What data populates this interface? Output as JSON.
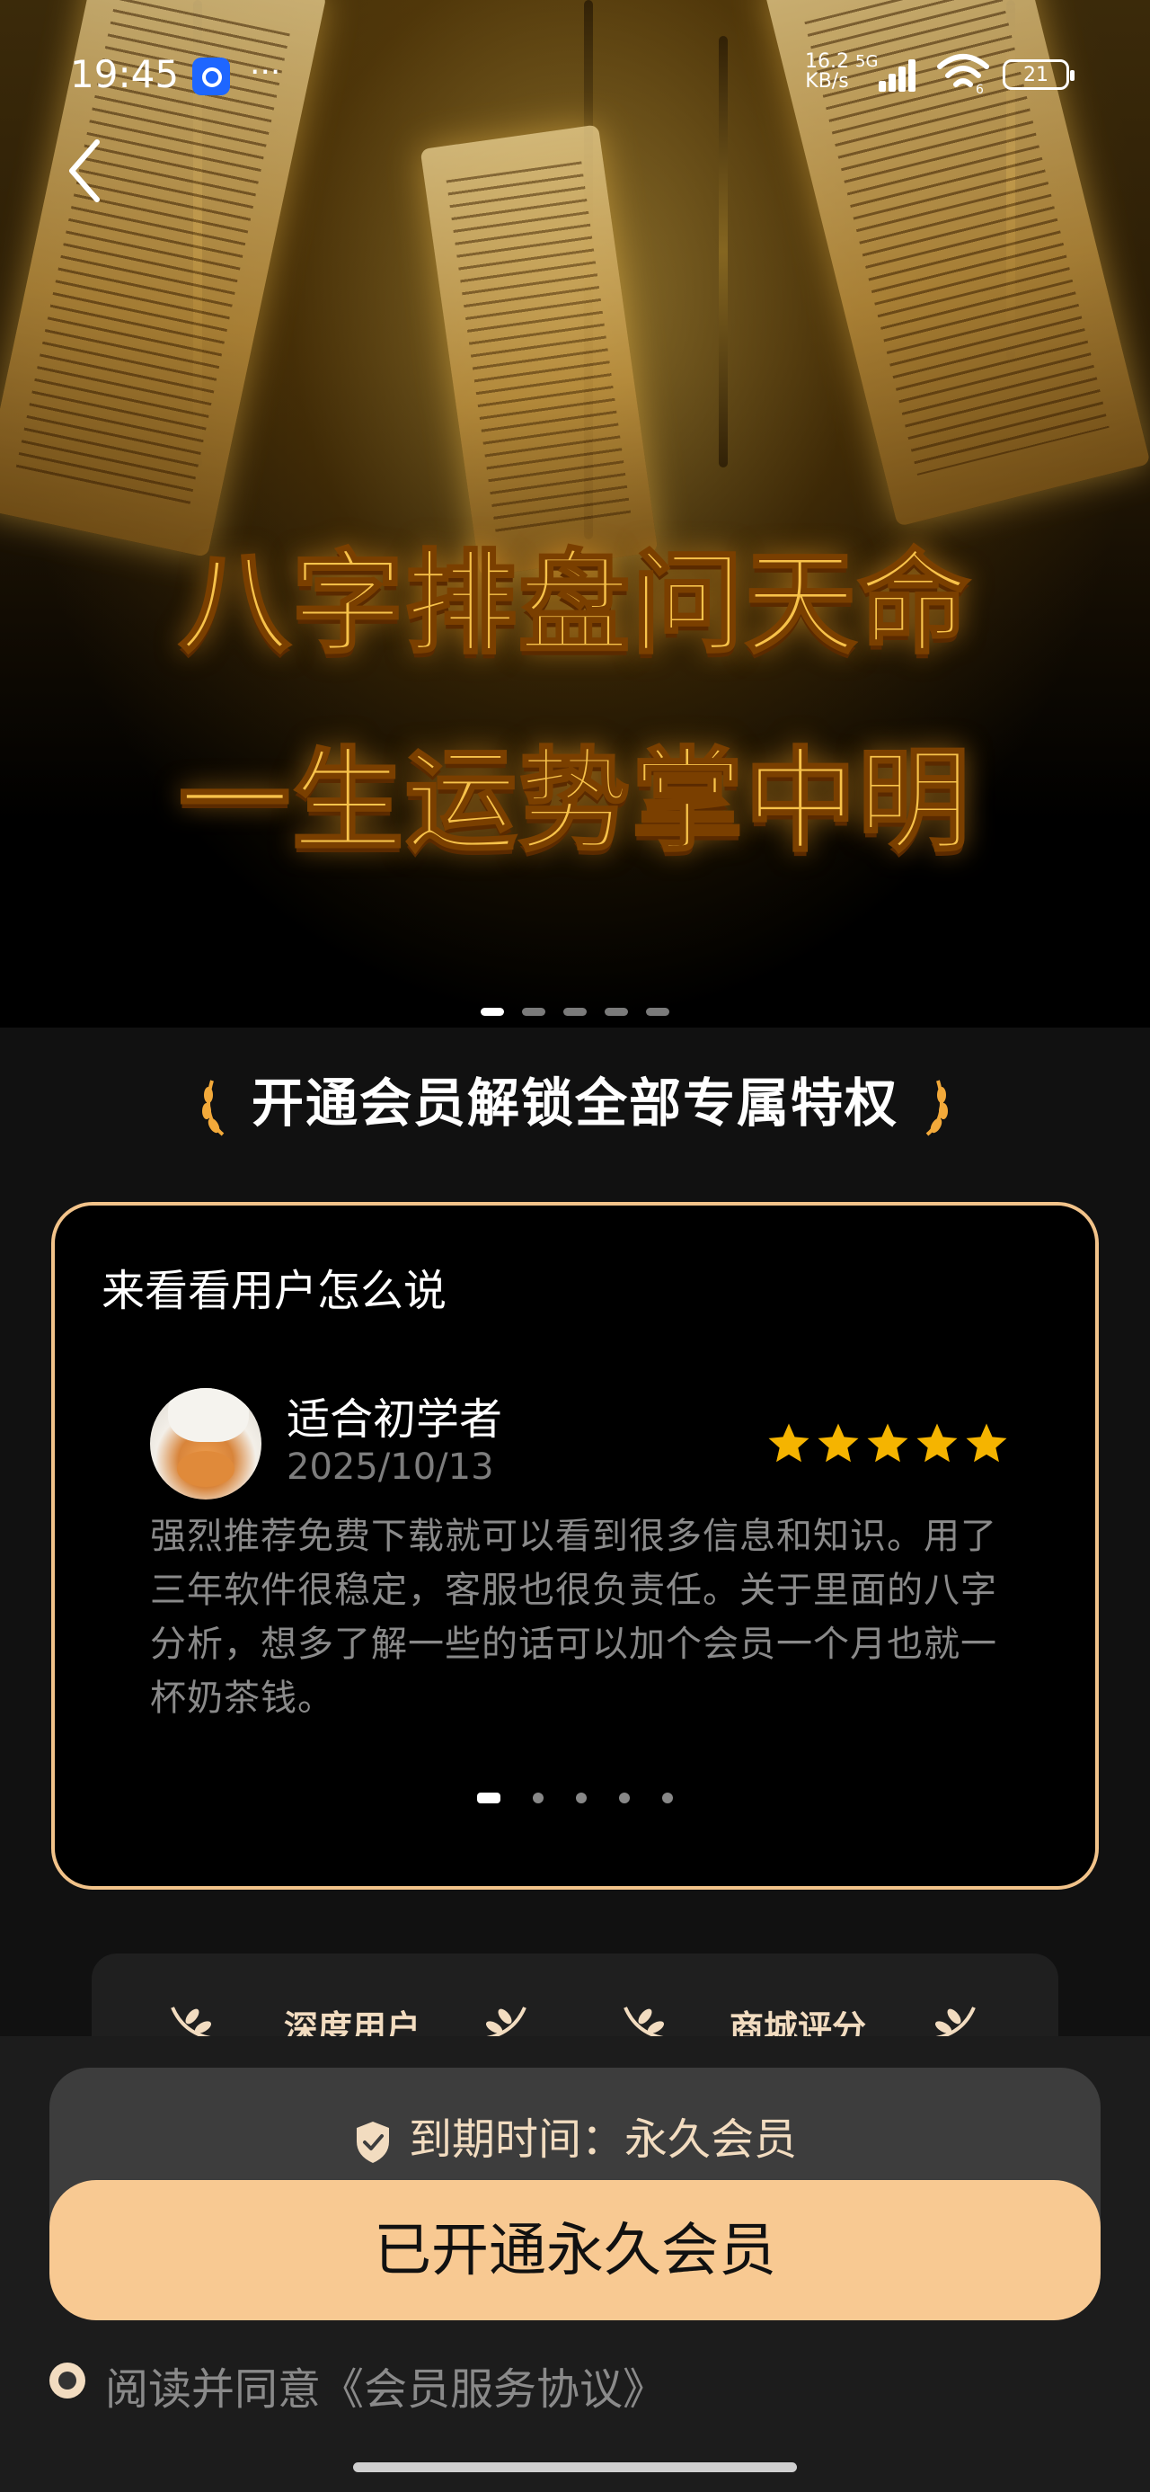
{
  "status_bar": {
    "time": "19:45",
    "more": "···",
    "net_speed_top": "16.2",
    "net_speed_bottom": "KB/s",
    "net_type": "5G",
    "wifi_level": "6",
    "battery": "21"
  },
  "hero": {
    "title_line1": "八字排盘问天命",
    "title_line2": "一生运势掌中明",
    "pages": 5,
    "active_page": 1
  },
  "privilege_header": "开通会员解锁全部专属特权",
  "testimonials": {
    "title": "来看看用户怎么说",
    "review": {
      "name": "适合初学者",
      "date": "2025/10/13",
      "rating": 5,
      "text": "强烈推荐免费下载就可以看到很多信息和知识。用了三年软件很稳定，客服也很负责任。关于里面的八字分析，想多了解一些的话可以加个会员一个月也就一杯奶茶钱。"
    },
    "pages": 5,
    "active_page": 1
  },
  "stats": {
    "item1": "深度用户",
    "item2": "商城评分"
  },
  "membership": {
    "expiry": "到期时间：永久会员",
    "cta": "已开通永久会员",
    "agreement": "阅读并同意《会员服务协议》"
  },
  "colors": {
    "accent": "#f8c992",
    "card_border": "#f2c38a",
    "hero_gold": "#f7c24a"
  }
}
